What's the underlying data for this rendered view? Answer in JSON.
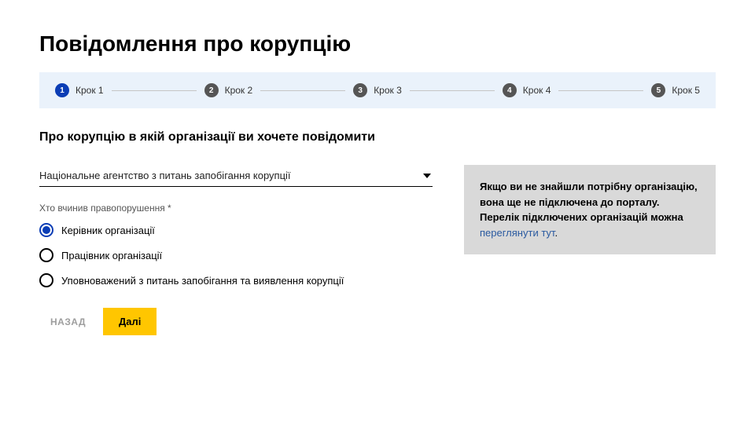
{
  "title": "Повідомлення про корупцію",
  "stepper": {
    "steps": [
      {
        "num": "1",
        "label": "Крок 1",
        "active": true
      },
      {
        "num": "2",
        "label": "Крок 2",
        "active": false
      },
      {
        "num": "3",
        "label": "Крок 3",
        "active": false
      },
      {
        "num": "4",
        "label": "Крок 4",
        "active": false
      },
      {
        "num": "5",
        "label": "Крок 5",
        "active": false
      }
    ]
  },
  "form": {
    "heading": "Про корупцію в якій організації ви хочете повідомити",
    "organization_select": {
      "value": "Національне агентство з питань запобігання корупції"
    },
    "offender_label": "Хто вчинив правопорушення *",
    "offender_options": [
      {
        "label": "Керівник організації",
        "selected": true
      },
      {
        "label": "Працівник організації",
        "selected": false
      },
      {
        "label": "Уповноважений з питань запобігання та виявлення корупції",
        "selected": false
      }
    ],
    "back_label": "НАЗАД",
    "next_label": "Далі"
  },
  "info": {
    "line1": "Якщо ви не знайшли потрібну організацію, вона ще не підключена до порталу.",
    "line2_prefix": "Перелік підключених організацій можна ",
    "link_text": "переглянути тут",
    "period": "."
  }
}
